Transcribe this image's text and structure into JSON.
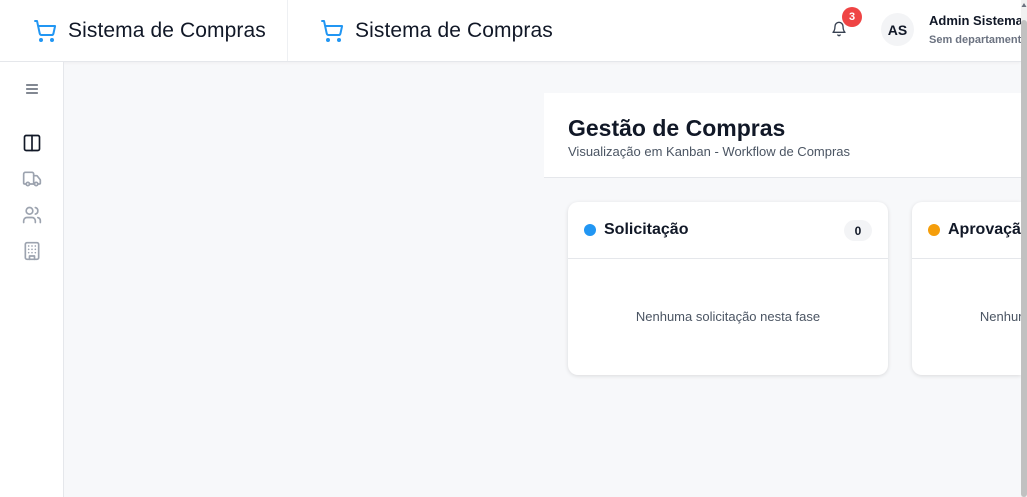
{
  "header": {
    "brand_primary": "Sistema de Compras",
    "brand_secondary": "Sistema de Compras",
    "notifications_count": "3",
    "user": {
      "initials": "AS",
      "name": "Admin Sistema",
      "department": "Sem departamento"
    }
  },
  "sidebar": {
    "items": [
      {
        "icon": "menu-icon"
      },
      {
        "icon": "kanban-board-icon"
      },
      {
        "icon": "truck-icon"
      },
      {
        "icon": "users-icon"
      },
      {
        "icon": "building-icon"
      }
    ]
  },
  "main": {
    "title": "Gestão de Compras",
    "subtitle": "Visualização em Kanban - Workflow de Compras",
    "columns": [
      {
        "title": "Solicitação",
        "count": "0",
        "empty_text": "Nenhuma solicitação nesta fase",
        "color": "#2196f3"
      },
      {
        "title": "Aprovação",
        "count": "",
        "empty_text": "Nenhuma solicitação nesta fase",
        "color": "#f59e0b"
      }
    ]
  },
  "colors": {
    "accent": "#2196f3",
    "badge": "#ef4444"
  }
}
